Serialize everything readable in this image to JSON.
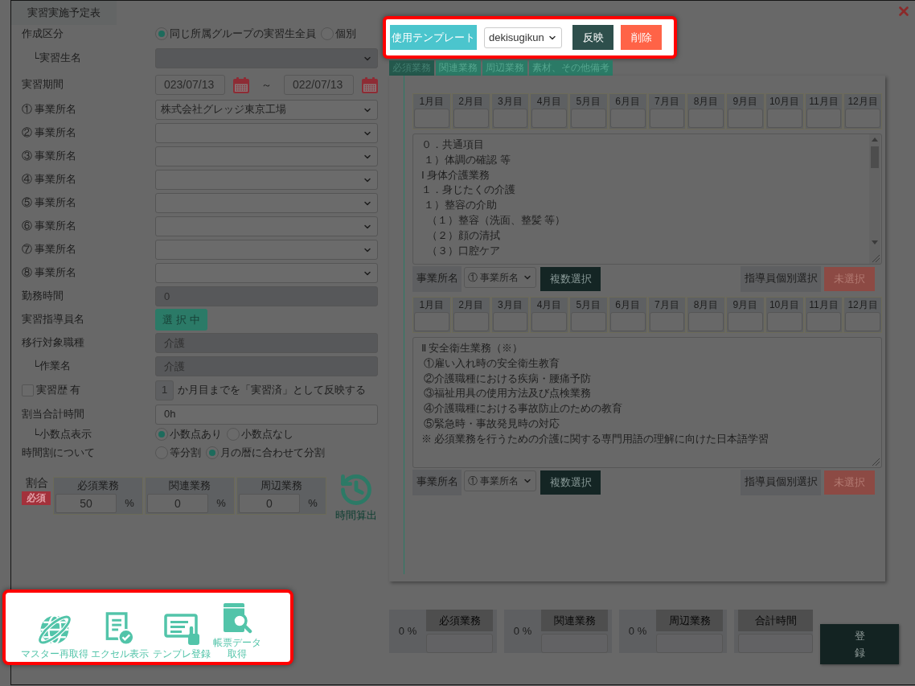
{
  "window": {
    "title": "実習実施予定表"
  },
  "form": {
    "creation_type": {
      "label": "作成区分",
      "options": [
        {
          "label": "同じ所属グループの実習生全員",
          "selected": true
        },
        {
          "label": "個別",
          "selected": false
        }
      ]
    },
    "trainee": {
      "label": "└実習生名",
      "disabled": true
    },
    "period": {
      "label": "実習期間",
      "start": "023/07/13",
      "separator": "～",
      "end": "022/07/13"
    },
    "offices": [
      {
        "label": "① 事業所名",
        "value": "株式会社グレッジ東京工場"
      },
      {
        "label": "② 事業所名"
      },
      {
        "label": "③ 事業所名"
      },
      {
        "label": "④ 事業所名"
      },
      {
        "label": "⑤ 事業所名"
      },
      {
        "label": "⑥ 事業所名"
      },
      {
        "label": "⑦ 事業所名"
      },
      {
        "label": "⑧ 事業所名"
      }
    ],
    "work_hours": {
      "label": "勤務時間",
      "value": "0",
      "disabled": true
    },
    "instructor": {
      "label": "実習指導員名",
      "button": "選 択 中"
    },
    "job_type": {
      "label": "移行対象職種",
      "value": "介護",
      "disabled": true
    },
    "task": {
      "label": "└作業名",
      "value": "介護",
      "disabled": true
    },
    "history": {
      "label": "実習歴 有",
      "checked": false,
      "months": "1",
      "note": "か月目までを「実習済」として反映する"
    },
    "total_hours": {
      "label": "割当合計時間",
      "value": "0h",
      "disabled": false
    },
    "decimal_display": {
      "label": "└小数点表示",
      "options": [
        {
          "label": "小数点あり",
          "selected": true
        },
        {
          "label": "小数点なし",
          "selected": false
        }
      ]
    },
    "time_split": {
      "label": "時間割について",
      "options": [
        {
          "label": "等分割",
          "selected": false
        },
        {
          "label": "月の暦に合わせて分割",
          "selected": true
        }
      ]
    },
    "ratio": {
      "label": "割合",
      "tag": "必須",
      "columns": [
        {
          "header": "必須業務",
          "value": "50",
          "unit": "%"
        },
        {
          "header": "関連業務",
          "value": "0",
          "unit": "%"
        },
        {
          "header": "周辺業務",
          "value": "0",
          "unit": "%"
        }
      ]
    },
    "calc_button": "時間算出"
  },
  "template_bar": {
    "label": "使用テンプレート",
    "template": "dekisugikun",
    "apply_button": "反映",
    "delete_button": "削除"
  },
  "tabs": [
    {
      "label": "必須業務",
      "selected": true
    },
    {
      "label": "関連業務",
      "selected": false
    },
    {
      "label": "周辺業務",
      "selected": false
    },
    {
      "label": "素材、その他備考",
      "selected": false
    }
  ],
  "sections": [
    {
      "months": [
        "1月目",
        "2月目",
        "3月目",
        "4月目",
        "5月目",
        "6月目",
        "7月目",
        "8月目",
        "9月目",
        "10月目",
        "11月目",
        "12月目"
      ],
      "text": [
        "０．共通項目",
        " １）体調の確認 等",
        "Ⅰ 身体介護業務",
        "１．身じたくの介護",
        " １）整容の介助",
        "  （１）整容（洗面、整髪 等）",
        "  （２）顔の清拭",
        "  （３）口腔ケア"
      ],
      "has_scrollbar": true,
      "office_label": "事業所名",
      "office_select": "① 事業所名",
      "multi_select_button": "複数選択",
      "instructor_label": "指導員個別選択",
      "instructor_button": "未選択"
    },
    {
      "months": [
        "1月目",
        "2月目",
        "3月目",
        "4月目",
        "5月目",
        "6月目",
        "7月目",
        "8月目",
        "9月目",
        "10月目",
        "11月目",
        "12月目"
      ],
      "text": [
        "Ⅱ 安全衛生業務（※）",
        " ①雇い入れ時の安全衛生教育",
        " ②介護職種における疾病・腰痛予防",
        " ③福祉用具の使用方法及び点検業務",
        " ④介護職種における事故防止のための教育",
        " ⑤緊急時・事故発見時の対応",
        "※ 必須業務を行うための介護に関する専門用語の理解に向けた日本語学習"
      ],
      "has_scrollbar": false,
      "office_label": "事業所名",
      "office_select": "① 事業所名",
      "multi_select_button": "複数選択",
      "instructor_label": "指導員個別選択",
      "instructor_button": "未選択"
    }
  ],
  "totals": [
    {
      "percent": "0 %",
      "header": "必須業務"
    },
    {
      "percent": "0 %",
      "header": "関連業務"
    },
    {
      "percent": "0 %",
      "header": "周辺業務"
    },
    {
      "header": "合計時間"
    }
  ],
  "register_button": "登録",
  "toolbar": [
    {
      "label": "マスター再取得"
    },
    {
      "label": "エクセル表示"
    },
    {
      "label": "テンプレ登録"
    },
    {
      "label": "帳票データ取得"
    }
  ]
}
